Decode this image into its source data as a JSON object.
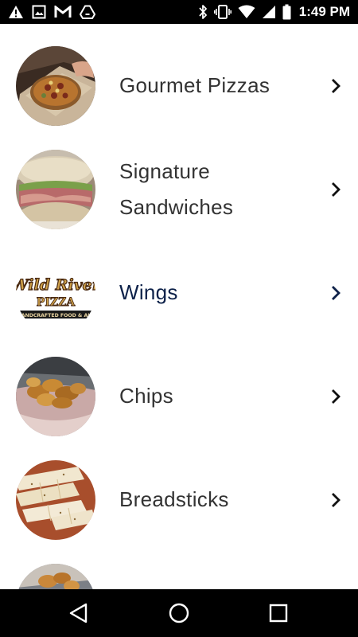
{
  "status_bar": {
    "time": "1:49 PM",
    "left_icons": [
      "warning-icon",
      "image-icon",
      "gmail-icon",
      "drive-icon"
    ],
    "right_icons": [
      "bluetooth-icon",
      "vibrate-icon",
      "wifi-icon",
      "cell-signal-icon",
      "battery-icon"
    ]
  },
  "menu": {
    "items": [
      {
        "label": "Gourmet Pizzas",
        "image": "pizza-photo",
        "active": false
      },
      {
        "label": "Signature Sandwiches",
        "image": "sandwich-photo",
        "active": false
      },
      {
        "label": "Wings",
        "image": "wild-river-pizza-logo",
        "active": true
      },
      {
        "label": "Chips",
        "image": "chips-photo",
        "active": false
      },
      {
        "label": "Breadsticks",
        "image": "breadsticks-photo",
        "active": false
      },
      {
        "label": "",
        "image": "partially-visible-photo",
        "active": false
      }
    ],
    "logo_text": {
      "line1": "Wild River",
      "line2": "PIZZA",
      "line3": "HANDCRAFTED FOOD & ALE"
    }
  },
  "nav_bar": {
    "buttons": [
      "back-icon",
      "home-icon",
      "recents-icon"
    ]
  },
  "colors": {
    "status_bar_bg": "#000000",
    "nav_bar_bg": "#000000",
    "label_text": "#333333",
    "active_label_text": "#0d2149",
    "chevron": "#111111",
    "active_chevron": "#0d2149"
  }
}
